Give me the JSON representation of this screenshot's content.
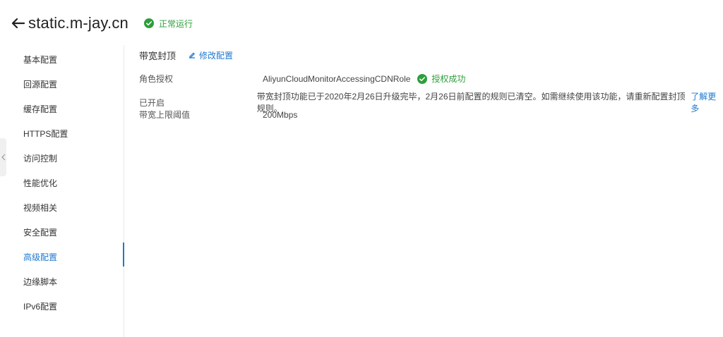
{
  "header": {
    "domain": "static.m-jay.cn",
    "status": "正常运行"
  },
  "sidebar": {
    "items": [
      {
        "label": "基本配置"
      },
      {
        "label": "回源配置"
      },
      {
        "label": "缓存配置"
      },
      {
        "label": "HTTPS配置"
      },
      {
        "label": "访问控制"
      },
      {
        "label": "性能优化"
      },
      {
        "label": "视频相关"
      },
      {
        "label": "安全配置"
      },
      {
        "label": "高级配置",
        "active": true
      },
      {
        "label": "边缘脚本"
      },
      {
        "label": "IPv6配置"
      }
    ]
  },
  "section": {
    "title": "带宽封顶",
    "edit_label": "修改配置",
    "rows": [
      {
        "label": "角色授权",
        "value": "AliyunCloudMonitorAccessingCDNRole",
        "badge": "授权成功"
      },
      {
        "label": "已开启",
        "value": "带宽封顶功能已于2020年2月26日升级完毕，2月26日前配置的规则已清空。如需继续使用该功能，请重新配置封顶规则。",
        "link": "了解更多"
      },
      {
        "label": "带宽上限阈值",
        "value": "200Mbps"
      }
    ]
  },
  "colors": {
    "accent": "#1e78d2",
    "success": "#2e9e3a"
  }
}
